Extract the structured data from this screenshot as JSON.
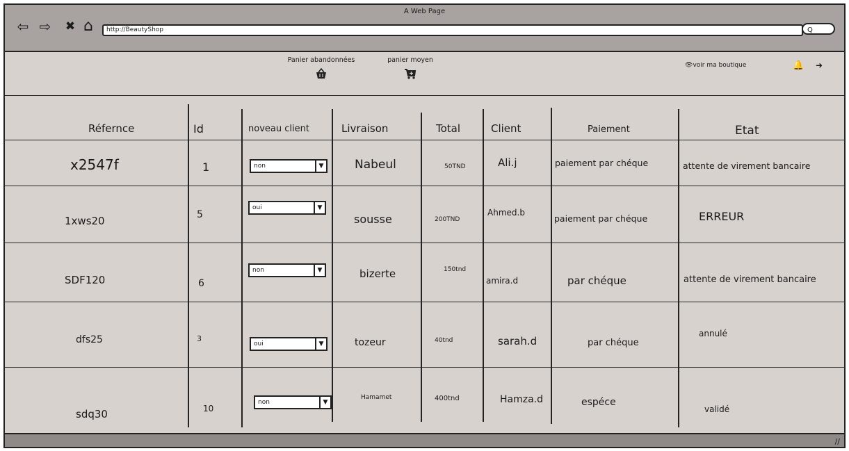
{
  "window": {
    "title": "A Web Page",
    "url": "http://BeautyShop"
  },
  "nav": {
    "back": "⇦",
    "forward": "⇨",
    "close": "✖",
    "home": "⌂",
    "search": "Q"
  },
  "toolbar": {
    "abandoned_label": "Panier abandonnées",
    "average_label": "panier moyen",
    "shop_label": "voir ma boutique"
  },
  "table": {
    "headers": [
      "Réfernce",
      "Id",
      "noveau client",
      "Livraison",
      "Total",
      "Client",
      "Paiement",
      "Etat"
    ],
    "rows": [
      {
        "ref": "x2547f",
        "id": "1",
        "new_client": "non",
        "delivery": "Nabeul",
        "total": "50TND",
        "client": "Ali.j",
        "payment": "paiement par chéque",
        "status": "attente de virement bancaire"
      },
      {
        "ref": "1xws20",
        "id": "5",
        "new_client": "oui",
        "delivery": "sousse",
        "total": "200TND",
        "client": "Ahmed.b",
        "payment": "paiement par chéque",
        "status": "ERREUR"
      },
      {
        "ref": "SDF120",
        "id": "6",
        "new_client": "non",
        "delivery": "bizerte",
        "total": "150tnd",
        "client": "amira.d",
        "payment": "par chéque",
        "status": "attente de virement bancaire"
      },
      {
        "ref": "dfs25",
        "id": "3",
        "new_client": "oui",
        "delivery": "tozeur",
        "total": "40tnd",
        "client": "sarah.d",
        "payment": "par chéque",
        "status": "annulé"
      },
      {
        "ref": "sdq30",
        "id": "10",
        "new_client": "non",
        "delivery": "Hamamet",
        "total": "400tnd",
        "client": "Hamza.d",
        "payment": "espéce",
        "status": "validé"
      }
    ]
  }
}
